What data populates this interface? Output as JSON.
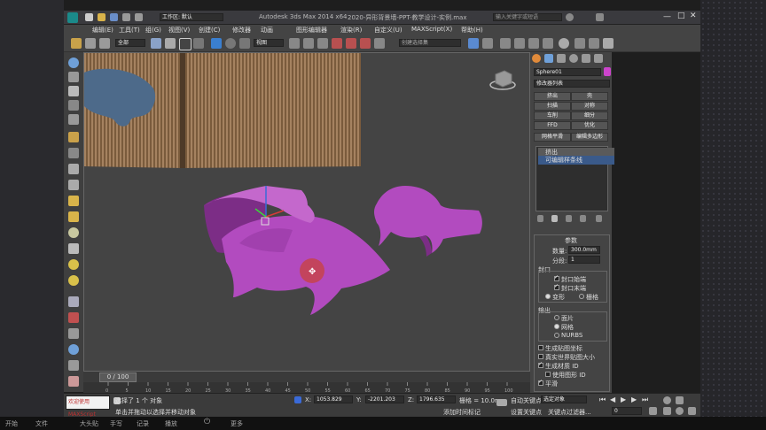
{
  "titlebar": {
    "workspace_label": "工作区: 默认",
    "app_title": "Autodesk 3ds Max  2014 x64",
    "file_title": "2020-异形背景墙-PPT-教学设计-实例.max",
    "search_placeholder": "输入关键字或短语"
  },
  "menu": [
    "编辑(E)",
    "工具(T)",
    "组(G)",
    "视图(V)",
    "创建(C)",
    "修改器",
    "动画",
    "图形编辑器",
    "渲染(R)",
    "自定义(U)",
    "MAXScript(X)",
    "帮助(H)"
  ],
  "toolbar": {
    "filter_value": "全部",
    "refcoord_value": "视图",
    "selection_set_placeholder": "创建选择集"
  },
  "command_panel": {
    "object_name": "Sphere01",
    "object_color": "#cc44cc",
    "modifier_list": "修改器列表",
    "modifier_buttons": [
      "挤出",
      "壳",
      "扫描",
      "对称",
      "车削",
      "细分",
      "FFD",
      "优化"
    ],
    "extra_buttons": [
      "网格平滑",
      "编辑多边形"
    ],
    "stack": [
      "挤出",
      "可编辑样条线"
    ],
    "params_title": "参数",
    "amount_label": "数量:",
    "amount_value": "300.0mm",
    "segments_label": "分段:",
    "segments_value": "1",
    "capping_label": "封口",
    "cap_start": "封口始端",
    "cap_end": "封口末端",
    "morph": "变形",
    "grid": "栅格",
    "output_label": "输出",
    "patch": "面片",
    "mesh": "网格",
    "nurbs": "NURBS",
    "gen_mapping": "生成贴图坐标",
    "real_world": "真实世界贴图大小",
    "gen_mat_ids": "生成材质 ID",
    "use_shape_ids": "使用图形 ID",
    "smooth": "平滑"
  },
  "timeline": {
    "frame_label": "0 / 100",
    "ticks": [
      "0",
      "5",
      "10",
      "15",
      "20",
      "25",
      "30",
      "35",
      "40",
      "45",
      "50",
      "55",
      "60",
      "65",
      "70",
      "75",
      "80",
      "85",
      "90",
      "95",
      "100"
    ]
  },
  "status": {
    "script_label": "欢迎使用 MAXScript",
    "selected_text": "选择了 1 个 对象",
    "prompt_text": "单击并拖动以选择并移动对象",
    "x_label": "X:",
    "x_value": "1053.829",
    "y_label": "Y:",
    "y_value": "-2201.203",
    "z_label": "Z:",
    "z_value": "1796.635",
    "grid_text": "栅格 = 10.0mm",
    "add_time_tag": "添加时间标记",
    "auto_key": "自动关键点",
    "selected_option": "选定对象",
    "set_key": "设置关键点",
    "key_filters": "关键点过滤器...",
    "frame_value": "0"
  },
  "taskbar": [
    "开始",
    "文件",
    "大头贴",
    "手写",
    "记录",
    "播放",
    "更多"
  ],
  "colors": {
    "fish": "#b24bbf",
    "fish_light": "#c468cc",
    "fish_dark": "#7c2d86",
    "wall_wood": "#8a6a4a",
    "wall_silhouette": "#4d6a8a",
    "viewport_bg": "#444444"
  }
}
